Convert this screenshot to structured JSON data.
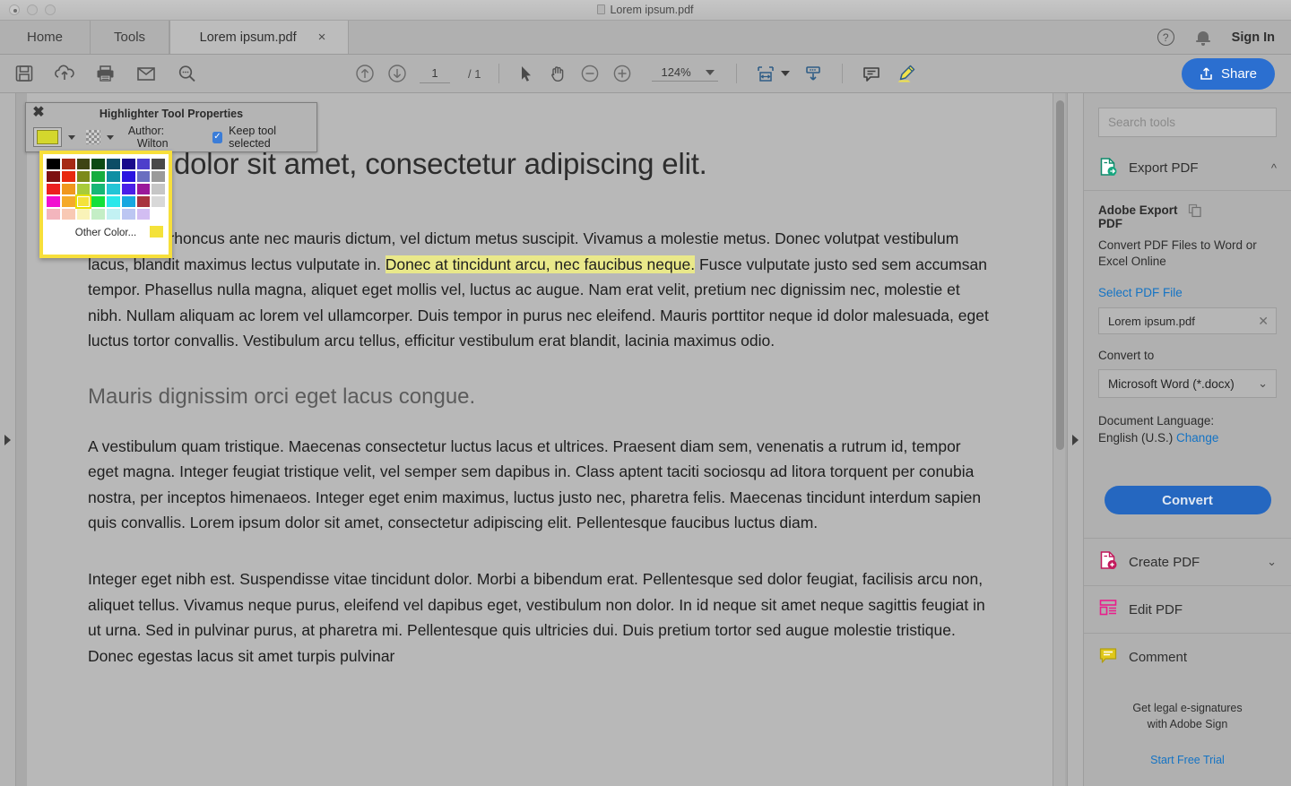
{
  "window": {
    "title": "Lorem ipsum.pdf",
    "doc_icon": "pdf-document-icon"
  },
  "tabs": {
    "home": "Home",
    "tools": "Tools",
    "document": "Lorem ipsum.pdf",
    "close": "×"
  },
  "account": {
    "help": "?",
    "sign_in": "Sign In"
  },
  "toolbar": {
    "save": "save-icon",
    "upload": "cloud-upload-icon",
    "print": "print-icon",
    "email": "email-icon",
    "search": "search-icon",
    "page_up": "page-up-icon",
    "page_down": "page-down-icon",
    "page_current": "1",
    "page_total": "/ 1",
    "select": "select-cursor-icon",
    "hand": "hand-tool-icon",
    "zoom_out": "zoom-out-icon",
    "zoom_in": "zoom-in-icon",
    "zoom_value": "124%",
    "fit_page": "fit-page-icon",
    "download": "download-icon",
    "comment": "comment-icon",
    "highlight": "highlighter-icon",
    "share": "Share"
  },
  "highlighter_panel": {
    "title": "Highlighter Tool Properties",
    "close": "✖",
    "color_swatch": "#d4d72d",
    "opacity_label": "opacity-checker",
    "author_label": "Author:",
    "author_value": "Wilton",
    "keep_tool_selected": "Keep tool selected",
    "keep_tool_checked": true
  },
  "color_picker": {
    "other_color": "Other Color...",
    "current_color": "#f4e23a",
    "selected_index": 26,
    "swatches": [
      "#000000",
      "#a62a15",
      "#3d4413",
      "#0d4a15",
      "#0b4d66",
      "#190a8c",
      "#4d3ecb",
      "#4a4a4a",
      "#7d1111",
      "#e8290f",
      "#7d8a1b",
      "#15ad3f",
      "#0e8fa3",
      "#2a14e0",
      "#6a6fc0",
      "#9a9a9a",
      "#ec2020",
      "#f0971d",
      "#a8cb3a",
      "#16b775",
      "#23c5d6",
      "#4a1fe8",
      "#9a189a",
      "#c6c6c6",
      "#f20fd0",
      "#f5aa2a",
      "#f4e23a",
      "#14e03a",
      "#2ae8ea",
      "#17a7e0",
      "#a8323f",
      "#d8d8d8",
      "#f3b5bd",
      "#f8c9b4",
      "#f9f3b8",
      "#c4eec6",
      "#c2f1f3",
      "#bcc6f2",
      "#d2bdf2",
      "#ffffff"
    ]
  },
  "document": {
    "title": "ipsum dolor sit amet, consectetur adipiscing elit.",
    "paragraph1_a": "Vestibulum rhoncus ante nec mauris dictum, vel dictum metus suscipit. Vivamus a molestie metus. Donec volutpat vestibulum lacus, blandit maximus lectus vulputate in. ",
    "paragraph1_highlight": "Donec at tincidunt arcu, nec faucibus neque.",
    "paragraph1_b": " Fusce vulputate justo sed sem accumsan tempor. Phasellus nulla magna, aliquet eget mollis vel, luctus ac augue. Nam erat velit, pretium nec dignissim nec, molestie et nibh. Nullam aliquam ac lorem vel ullamcorper. Duis tempor in purus nec eleifend. Mauris porttitor neque id dolor malesuada, eget luctus tortor convallis. Vestibulum arcu tellus, efficitur vestibulum erat blandit, lacinia maximus odio.",
    "heading2": "Mauris dignissim orci eget lacus congue.",
    "paragraph2": "A vestibulum quam tristique. Maecenas consectetur luctus lacus et ultrices. Praesent diam sem, venenatis a rutrum id, tempor eget magna. Integer feugiat tristique velit, vel semper sem dapibus in. Class aptent taciti sociosqu ad litora torquent per conubia nostra, per inceptos himenaeos. Integer eget enim maximus, luctus justo nec, pharetra felis. Maecenas tincidunt interdum sapien quis convallis. Lorem ipsum dolor sit amet, consectetur adipiscing elit. Pellentesque faucibus luctus diam.",
    "paragraph3": "Integer eget nibh est. Suspendisse vitae tincidunt dolor. Morbi a bibendum erat. Pellentesque sed dolor feugiat, facilisis arcu non, aliquet tellus. Vivamus neque purus, eleifend vel dapibus eget, vestibulum non dolor. In id neque sit amet neque sagittis feugiat in ut urna. Sed in pulvinar purus, at pharetra mi. Pellentesque quis ultricies dui. Duis pretium tortor sed augue molestie tristique. Donec egestas lacus sit amet turpis pulvinar"
  },
  "tools_panel": {
    "search_placeholder": "Search tools",
    "export_pdf": "Export PDF",
    "export_card": {
      "title": "Adobe Export PDF",
      "description": "Convert PDF Files to Word or Excel Online",
      "select_file_link": "Select PDF File",
      "file_name": "Lorem ipsum.pdf",
      "convert_to_label": "Convert to",
      "convert_to_value": "Microsoft Word (*.docx)",
      "doc_language_label": "Document Language:",
      "doc_language_value": "English (U.S.)",
      "change_link": "Change",
      "convert_button": "Convert"
    },
    "create_pdf": "Create PDF",
    "edit_pdf": "Edit PDF",
    "comment": "Comment",
    "promo_line1": "Get legal e-signatures",
    "promo_line2": "with Adobe Sign",
    "trial_link": "Start Free Trial"
  },
  "colors": {
    "accent_blue": "#2b6fd0",
    "link_blue": "#1473c4",
    "highlight_yellow": "#e9e88a",
    "picker_border": "#f7df3a"
  }
}
